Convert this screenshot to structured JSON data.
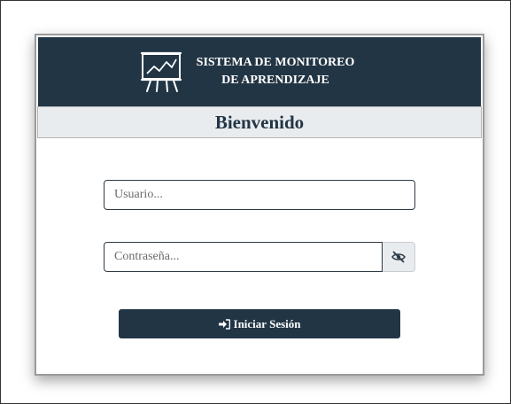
{
  "header": {
    "title_line1": "SISTEMA DE MONITOREO",
    "title_line2": "DE APRENDIZAJE",
    "logo_icon": "presentation-chart-icon",
    "background_color": "#223545"
  },
  "welcome": {
    "text": "Bienvenido"
  },
  "form": {
    "username_placeholder": "Usuario...",
    "username_value": "",
    "password_placeholder": "Contraseña...",
    "password_value": "",
    "toggle_password_icon": "eye-slash-icon",
    "login_icon": "sign-in-icon",
    "login_label": "Iniciar Sesión"
  },
  "colors": {
    "primary": "#223545",
    "bar": "#e9ecef"
  }
}
